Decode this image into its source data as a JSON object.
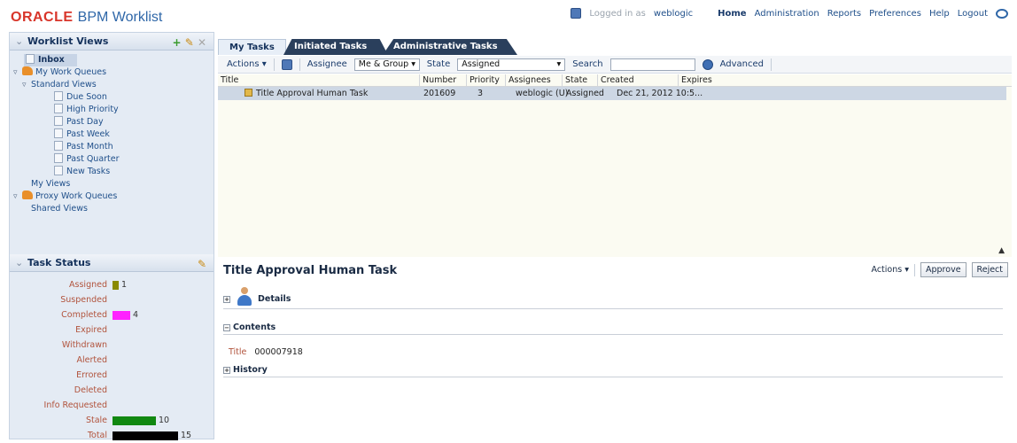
{
  "header": {
    "brand_oracle": "ORACLE",
    "brand_product": "BPM Worklist",
    "logged_in_label": "Logged in as",
    "username": "weblogic",
    "nav": [
      "Home",
      "Administration",
      "Reports",
      "Preferences",
      "Help",
      "Logout"
    ]
  },
  "worklist_views": {
    "title": "Worklist Views",
    "items": [
      {
        "label": "Inbox"
      },
      {
        "label": "My Work Queues"
      },
      {
        "label": "Standard Views"
      },
      {
        "label": "Due Soon"
      },
      {
        "label": "High Priority"
      },
      {
        "label": "Past Day"
      },
      {
        "label": "Past Week"
      },
      {
        "label": "Past Month"
      },
      {
        "label": "Past Quarter"
      },
      {
        "label": "New Tasks"
      },
      {
        "label": "My Views"
      },
      {
        "label": "Proxy Work Queues"
      },
      {
        "label": "Shared Views"
      }
    ]
  },
  "task_status": {
    "title": "Task Status",
    "rows": [
      {
        "label": "Assigned",
        "count": "1",
        "value": 1,
        "color": "#8a8a00"
      },
      {
        "label": "Suspended",
        "count": "",
        "value": 0,
        "color": ""
      },
      {
        "label": "Completed",
        "count": "4",
        "value": 4,
        "color": "#ff22ff"
      },
      {
        "label": "Expired",
        "count": "",
        "value": 0,
        "color": ""
      },
      {
        "label": "Withdrawn",
        "count": "",
        "value": 0,
        "color": ""
      },
      {
        "label": "Alerted",
        "count": "",
        "value": 0,
        "color": ""
      },
      {
        "label": "Errored",
        "count": "",
        "value": 0,
        "color": ""
      },
      {
        "label": "Deleted",
        "count": "",
        "value": 0,
        "color": ""
      },
      {
        "label": "Info Requested",
        "count": "",
        "value": 0,
        "color": ""
      },
      {
        "label": "Stale",
        "count": "10",
        "value": 10,
        "color": "#118811"
      },
      {
        "label": "Total",
        "count": "15",
        "value": 15,
        "color": "#000000"
      }
    ]
  },
  "tabs": [
    "My Tasks",
    "Initiated Tasks",
    "Administrative Tasks"
  ],
  "toolbar": {
    "actions_label": "Actions ▾",
    "assignee_label": "Assignee",
    "assignee_value": "Me & Group ▾",
    "state_label": "State",
    "state_value": "Assigned",
    "search_label": "Search",
    "search_value": "",
    "advanced_label": "Advanced"
  },
  "task_table": {
    "columns": [
      "Title",
      "Number",
      "Priority",
      "Assignees",
      "State",
      "Created",
      "Expires"
    ],
    "rows": [
      {
        "title": "Title Approval Human Task",
        "number": "201609",
        "priority": "3",
        "assignees": "weblogic (U)",
        "state": "Assigned",
        "created": "Dec 21, 2012 10:5...",
        "expires": ""
      }
    ]
  },
  "detail": {
    "title": "Title Approval Human Task",
    "actions_label": "Actions ▾",
    "approve_label": "Approve",
    "reject_label": "Reject",
    "details_label": "Details",
    "contents_label": "Contents",
    "field_title_label": "Title",
    "field_title_value": "000007918",
    "history_label": "History"
  }
}
